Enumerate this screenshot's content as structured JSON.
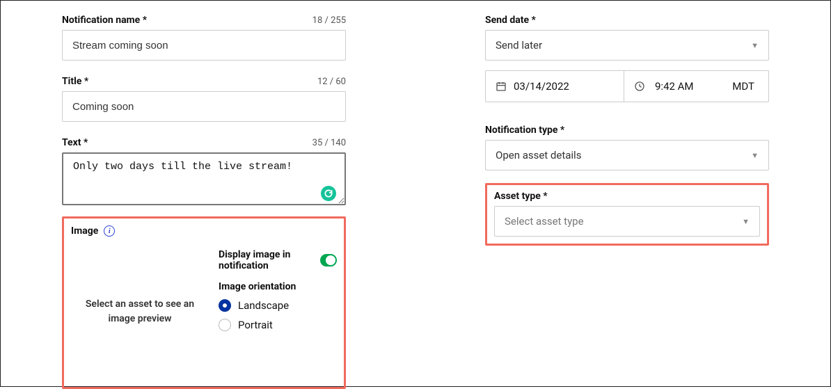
{
  "left": {
    "name_label": "Notification name *",
    "name_counter": "18 / 255",
    "name_value": "Stream coming soon",
    "title_label": "Title *",
    "title_counter": "12 / 60",
    "title_value": "Coming soon",
    "text_label": "Text *",
    "text_counter": "35 / 140",
    "text_value": "Only two days till the live stream!",
    "image_label": "Image",
    "preview_placeholder": "Select an asset to see an image preview",
    "display_toggle_label": "Display image in notification",
    "display_toggle_on": true,
    "orientation_label": "Image orientation",
    "orientation_options": {
      "landscape": "Landscape",
      "portrait": "Portrait"
    },
    "orientation_selected": "landscape"
  },
  "right": {
    "send_label": "Send date *",
    "send_select_value": "Send later",
    "date_value": "03/14/2022",
    "time_value": "9:42 AM",
    "timezone": "MDT",
    "notif_type_label": "Notification type *",
    "notif_type_value": "Open asset details",
    "asset_type_label": "Asset type *",
    "asset_type_placeholder": "Select asset type"
  }
}
